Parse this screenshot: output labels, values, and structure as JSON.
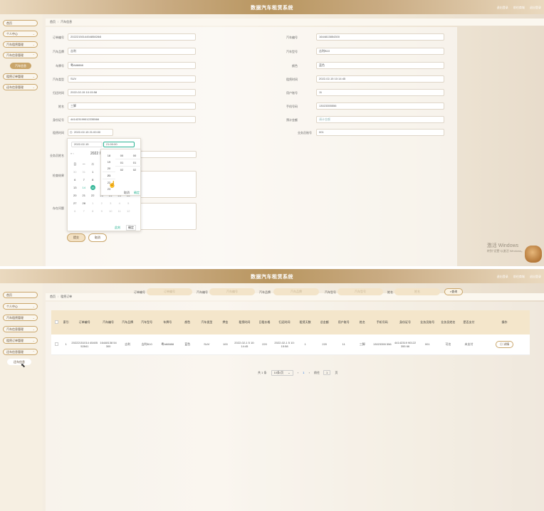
{
  "app_title": "数据汽车租赁系统",
  "header_links": [
    "退出登录",
    "前往商城",
    "退出登录"
  ],
  "nav": [
    {
      "label": "首页"
    },
    {
      "label": "个人中心"
    },
    {
      "label": "汽车租赁管理"
    },
    {
      "label": "汽车信息管理"
    },
    {
      "label": "租赁订单管理"
    },
    {
      "label": "还车信息管理"
    }
  ],
  "screen1": {
    "nav_sub_active": "汽车信息",
    "breadcrumb": [
      "首页",
      "汽车信息"
    ],
    "form_left": [
      {
        "label": "订单编号",
        "value": "2022215014454858284I"
      },
      {
        "label": "汽车品牌",
        "value": "吉利"
      },
      {
        "label": "车牌号",
        "value": "粤A88888"
      },
      {
        "label": "汽车类型",
        "value": "SUV"
      },
      {
        "label": "归还时间",
        "value": "2022-02-15 10:15:58"
      },
      {
        "label": "姓名",
        "value": "三脚"
      },
      {
        "label": "身份证号",
        "value": "441423199012235566"
      },
      {
        "label": "租赁时间",
        "value": "2022-02-15 21:00:00"
      }
    ],
    "form_right": [
      {
        "label": "汽车编号",
        "value": "1644813854300"
      },
      {
        "label": "汽车型号",
        "value": "吉利B10"
      },
      {
        "label": "颜色",
        "value": "蓝色"
      },
      {
        "label": "租赁时间",
        "value": "2022-02-15 10:14:45"
      },
      {
        "label": "用户账号",
        "value": "11"
      },
      {
        "label": "手机号码",
        "value": "13023355556"
      },
      {
        "label": "预计金额",
        "value": "请计金额"
      },
      {
        "label": "业务员账号",
        "value": "001"
      }
    ],
    "extra_labels": [
      "业务员姓名",
      "检查结果",
      "存在问题"
    ],
    "datepicker": {
      "date_input": "2022-02-15",
      "time_input": "21:00:00",
      "month_title": "2022 年",
      "prev": "« ‹",
      "weekdays": [
        "日",
        "一",
        "二",
        "三",
        "四",
        "五",
        "六"
      ],
      "weeks": [
        [
          "30",
          "31",
          "1",
          "2",
          "3",
          "4",
          "5"
        ],
        [
          "6",
          "7",
          "8",
          "9",
          "10",
          "11",
          "12"
        ],
        [
          "13",
          "14",
          "15",
          "16",
          "17",
          "18",
          "19"
        ],
        [
          "20",
          "21",
          "22",
          "23",
          "24",
          "25",
          "26"
        ],
        [
          "27",
          "28",
          "1",
          "2",
          "3",
          "4",
          "5"
        ],
        [
          "6",
          "7",
          "8",
          "9",
          "10",
          "11",
          "12"
        ]
      ],
      "today": "15",
      "now_label": "此刻",
      "ok_label": "确定"
    },
    "timepicker": {
      "hours": [
        "18",
        "19",
        "20",
        "21",
        "22",
        "23"
      ],
      "minutes": [
        "",
        "",
        "00",
        "01",
        "02"
      ],
      "seconds": [
        "",
        "",
        "00",
        "01",
        "02"
      ],
      "cancel": "取消",
      "confirm": "确定"
    },
    "submit_label": "提交",
    "cancel_label": "取消",
    "watermark_title": "激活 Windows",
    "watermark_sub": "转到\"设置\"以激活 Windows。"
  },
  "screen2": {
    "nav_sub_active": "还车信息",
    "breadcrumb": [
      "首页",
      "租赁订单"
    ],
    "search": [
      {
        "label": "订单编号",
        "placeholder": "订单编号"
      },
      {
        "label": "汽车编号",
        "placeholder": "汽车编号"
      },
      {
        "label": "汽车品牌",
        "placeholder": "汽车品牌"
      },
      {
        "label": "汽车型号",
        "placeholder": "汽车型号"
      },
      {
        "label": "姓名",
        "placeholder": "姓名"
      }
    ],
    "search_button": "查询",
    "columns": [
      "索引",
      "订单编号",
      "汽车编号",
      "汽车品牌",
      "汽车型号",
      "车牌号",
      "颜色",
      "汽车类型",
      "押金",
      "租赁时间",
      "日租价格",
      "归还时间",
      "租赁天数",
      "总金额",
      "用户账号",
      "姓名",
      "手机号码",
      "身份证号",
      "业务员账号",
      "业务员姓名",
      "是否支付",
      "操作"
    ],
    "rows": [
      [
        "1",
        "20222151014 4540552841",
        "16448138 54300",
        "吉利",
        "吉利B10",
        "粤A88888",
        "蓝色",
        "SUV",
        "100",
        "2022-02-1 5 10:14:45",
        "220",
        "2022-02-1 5 10:15:58",
        "1",
        "220",
        "11",
        "三脚",
        "13023355 556",
        "44142319 90122355 66",
        "001",
        "可名",
        "未支付",
        "详情"
      ]
    ],
    "pager": {
      "total": "共 1 条",
      "size": "10条/页",
      "page": "1",
      "goto": "前往",
      "goto_page": "1",
      "page_suffix": "页"
    }
  }
}
